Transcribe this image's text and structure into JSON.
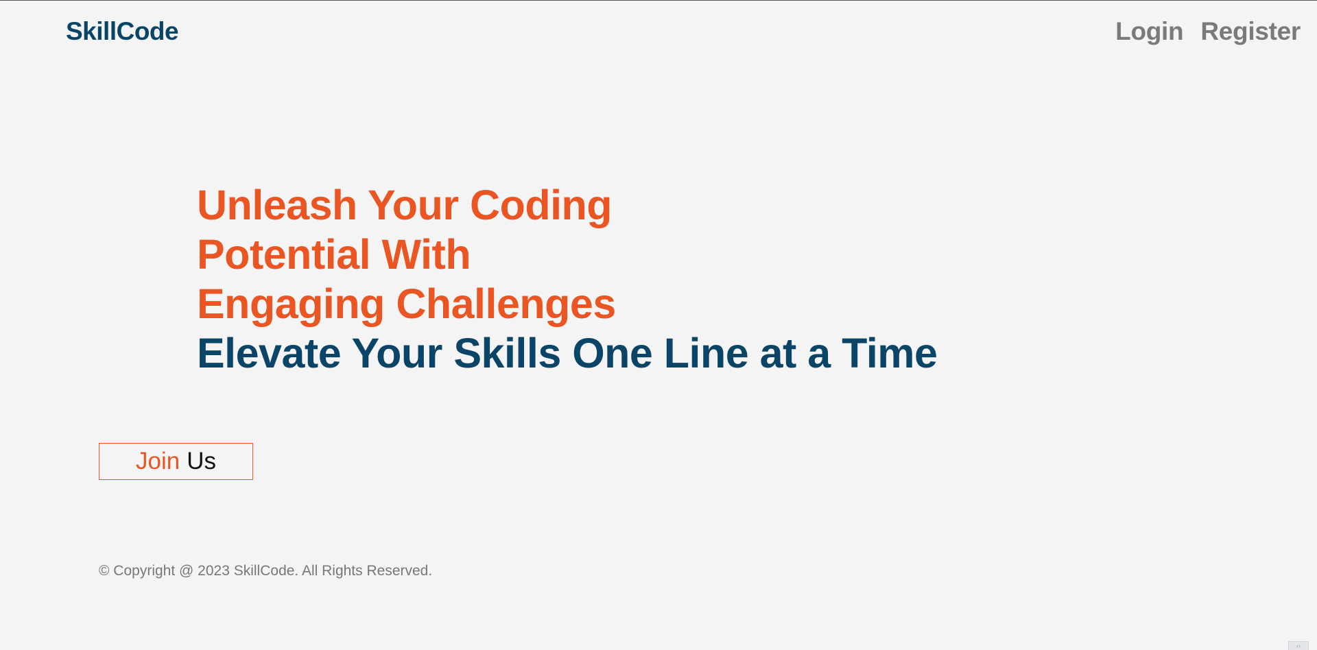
{
  "header": {
    "brand": "SkillCode",
    "nav": {
      "login": "Login",
      "register": "Register"
    }
  },
  "hero": {
    "line1": "Unleash Your Coding",
    "line2": "Potential With",
    "line3": "Engaging Challenges",
    "subtitle": "Elevate Your Skills One Line at a Time"
  },
  "cta": {
    "join_word1": "Join",
    "join_word2": "Us"
  },
  "footer": {
    "copyright": "© Copyright @ 2023 SkillCode. All Rights Reserved."
  },
  "colors": {
    "accent": "#ea5524",
    "brand": "#0a4466",
    "nav": "#7a7a7a",
    "background": "#f4f4f4"
  }
}
